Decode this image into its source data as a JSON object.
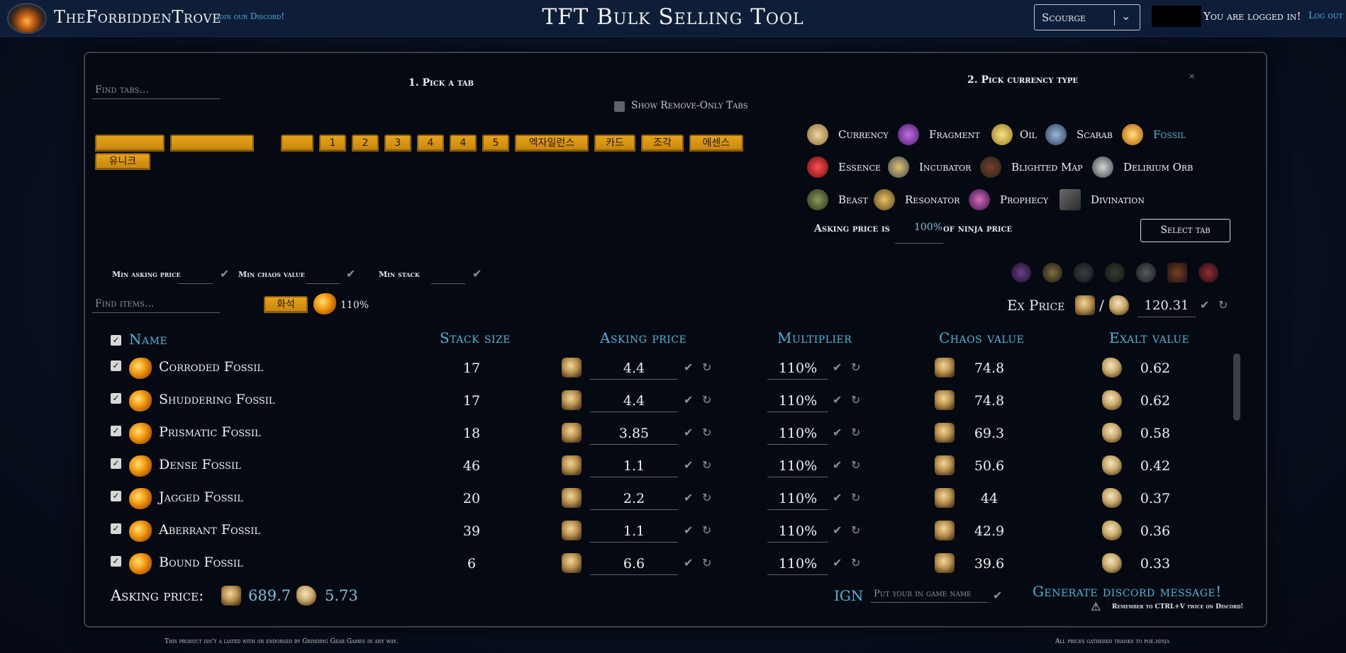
{
  "header": {
    "brand": "TheForbiddenTrove",
    "discord_link": "join our Discord!",
    "title": "TFT Bulk Selling Tool",
    "league": "Scourge",
    "logged_in": "You are logged in!",
    "logout": "Log out"
  },
  "pick_tab": {
    "title": "1. Pick a tab",
    "search_placeholder": "Find tabs...",
    "show_remove_only": "Show Remove-Only Tabs",
    "tabs": [
      "",
      "",
      "",
      "1",
      "2",
      "3",
      "4",
      "4",
      "5",
      "엑자일런스",
      "카드",
      "조각",
      "에센스",
      "유니크"
    ]
  },
  "pick_currency": {
    "title": "2. Pick currency type",
    "types": [
      {
        "label": "Currency",
        "icon": "currency-icon",
        "active": false
      },
      {
        "label": "Fragment",
        "icon": "fragment-icon",
        "active": false
      },
      {
        "label": "Oil",
        "icon": "oil-icon",
        "active": false
      },
      {
        "label": "Scarab",
        "icon": "scarab-icon",
        "active": false
      },
      {
        "label": "Fossil",
        "icon": "fossil-icon",
        "active": true
      },
      {
        "label": "Essence",
        "icon": "essence-icon",
        "active": false
      },
      {
        "label": "Incubator",
        "icon": "incubator-icon",
        "active": false
      },
      {
        "label": "Blighted Map",
        "icon": "blighted-map-icon",
        "active": false
      },
      {
        "label": "Delirium Orb",
        "icon": "delirium-orb-icon",
        "active": false
      },
      {
        "label": "Beast",
        "icon": "beast-icon",
        "active": false
      },
      {
        "label": "Resonator",
        "icon": "resonator-icon",
        "active": false
      },
      {
        "label": "Prophecy",
        "icon": "prophecy-icon",
        "active": false
      },
      {
        "label": "Divination",
        "icon": "divination-icon",
        "active": false
      }
    ],
    "asking_price_prefix": "Asking price is",
    "asking_price_percent": "100%",
    "asking_price_suffix": "of ninja price",
    "select_tab_button": "Select tab"
  },
  "filters": {
    "min_asking_price": "Min asking price",
    "min_chaos_value": "Min chaos value",
    "min_stack": "Min stack",
    "find_items_placeholder": "Find items...",
    "selected_tab": "화석",
    "tab_multiplier": "110%",
    "ex_price_label": "Ex Price",
    "ex_price_separator": "/",
    "ex_price_value": "120.31"
  },
  "table": {
    "headers": {
      "name": "Name",
      "stack_size": "Stack size",
      "asking_price": "Asking price",
      "multiplier": "Multiplier",
      "chaos_value": "Chaos value",
      "exalt_value": "Exalt value"
    },
    "rows": [
      {
        "name": "Corroded Fossil",
        "stack": "17",
        "asking": "4.4",
        "multiplier": "110%",
        "chaos": "74.8",
        "exalt": "0.62"
      },
      {
        "name": "Shuddering Fossil",
        "stack": "17",
        "asking": "4.4",
        "multiplier": "110%",
        "chaos": "74.8",
        "exalt": "0.62"
      },
      {
        "name": "Prismatic Fossil",
        "stack": "18",
        "asking": "3.85",
        "multiplier": "110%",
        "chaos": "69.3",
        "exalt": "0.58"
      },
      {
        "name": "Dense Fossil",
        "stack": "46",
        "asking": "1.1",
        "multiplier": "110%",
        "chaos": "50.6",
        "exalt": "0.42"
      },
      {
        "name": "Jagged Fossil",
        "stack": "20",
        "asking": "2.2",
        "multiplier": "110%",
        "chaos": "44",
        "exalt": "0.37"
      },
      {
        "name": "Aberrant Fossil",
        "stack": "39",
        "asking": "1.1",
        "multiplier": "110%",
        "chaos": "42.9",
        "exalt": "0.36"
      },
      {
        "name": "Bound Fossil",
        "stack": "6",
        "asking": "6.6",
        "multiplier": "110%",
        "chaos": "39.6",
        "exalt": "0.33"
      }
    ]
  },
  "totals": {
    "label": "Asking price:",
    "chaos_total": "689.7",
    "exalt_total": "5.73"
  },
  "ign": {
    "label": "IGN",
    "placeholder": "Put your in game name"
  },
  "generate": {
    "button": "Generate discord message!",
    "note": "Remember to CTRL+V twice on Discord!"
  },
  "footer": {
    "left": "This product isn't a  liated with or endorsed by Grinding Gear Games in any way.",
    "right": "All prices gathered thanks to poe.ninja"
  },
  "colors": {
    "accent": "#4bb4d8",
    "tab_gold": "#e6a31a",
    "panel_bg": "#050912",
    "header_bg": "#0f1e38"
  }
}
